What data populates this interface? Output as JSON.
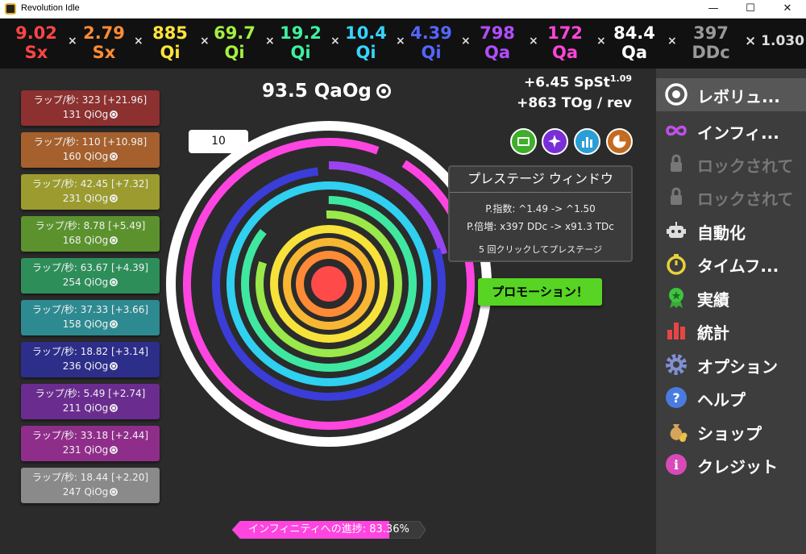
{
  "window": {
    "title": "Revolution Idle",
    "minimize": "—",
    "maximize": "☐",
    "close": "✕"
  },
  "multipliers": [
    {
      "value": "9.02",
      "suffix": "Sx",
      "color": "#ff4545"
    },
    {
      "value": "2.79",
      "suffix": "Sx",
      "color": "#ff8c35"
    },
    {
      "value": "885",
      "suffix": "Qi",
      "color": "#ffe43a"
    },
    {
      "value": "69.7",
      "suffix": "Qi",
      "color": "#a4f040"
    },
    {
      "value": "19.2",
      "suffix": "Qi",
      "color": "#3ff0a0"
    },
    {
      "value": "10.4",
      "suffix": "Qi",
      "color": "#35d5ff"
    },
    {
      "value": "4.39",
      "suffix": "Qi",
      "color": "#5566ff"
    },
    {
      "value": "798",
      "suffix": "Qa",
      "color": "#b24dff"
    },
    {
      "value": "172",
      "suffix": "Qa",
      "color": "#ff45d8"
    },
    {
      "value": "84.4",
      "suffix": "Qa",
      "color": "#ffffff"
    },
    {
      "value": "397",
      "suffix": "DDc",
      "color": "#999999"
    }
  ],
  "multiplier_sep": "×",
  "final_multiplier": "× 1.030",
  "rings": [
    {
      "rate": "ラップ/秒: 323 [+21.96]",
      "cost": "131 QiOg",
      "color": "#8c3030"
    },
    {
      "rate": "ラップ/秒: 110 [+10.98]",
      "cost": "160 QiOg",
      "color": "#a5602d"
    },
    {
      "rate": "ラップ/秒: 42.45 [+7.32]",
      "cost": "231 QiOg",
      "color": "#9b9b2f"
    },
    {
      "rate": "ラップ/秒: 8.78 [+5.49]",
      "cost": "168 QiOg",
      "color": "#5b922e"
    },
    {
      "rate": "ラップ/秒: 63.67 [+4.39]",
      "cost": "254 QiOg",
      "color": "#2e8e5a"
    },
    {
      "rate": "ラップ/秒: 37.33 [+3.66]",
      "cost": "158 QiOg",
      "color": "#2e8a91"
    },
    {
      "rate": "ラップ/秒: 18.82 [+3.14]",
      "cost": "236 QiOg",
      "color": "#2d2d8a"
    },
    {
      "rate": "ラップ/秒: 5.49 [+2.74]",
      "cost": "211 QiOg",
      "color": "#6a2d8f"
    },
    {
      "rate": "ラップ/秒: 33.18 [+2.44]",
      "cost": "231 QiOg",
      "color": "#8f2d8a"
    },
    {
      "rate": "ラップ/秒: 18.44 [+2.20]",
      "cost": "247 QiOg",
      "color": "#8a8a8a"
    }
  ],
  "currency": {
    "amount": "93.5 QaOg"
  },
  "rates": {
    "spst": "+6.45 SpSt",
    "spst_exp": "1.09",
    "per_rev": "+863 TOg / rev"
  },
  "count_box": "10",
  "buttons": [
    {
      "name": "cash-icon",
      "color": "#3fae2a"
    },
    {
      "name": "sparkle-icon",
      "color": "#7a2fd6"
    },
    {
      "name": "bar-chart-icon",
      "color": "#2a9ed6"
    },
    {
      "name": "pie-chart-icon",
      "color": "#c46a1f"
    }
  ],
  "prestige": {
    "title": "プレステージ ウィンドウ",
    "exponent": "P.指数: ^1.49 -> ^1.50",
    "multiplier": "P.倍増: x397 DDc -> x91.3 TDc",
    "hint": "5 回クリックしてプレステージ"
  },
  "promotion": "プロモーション！",
  "progress": {
    "label": "インフィニティへの進捗: 83.36%",
    "fraction": 0.8336,
    "fill": "#ff45e0"
  },
  "sidebar": [
    {
      "label": "レボリュ...",
      "icon": "target-icon",
      "active": true,
      "locked": false
    },
    {
      "label": "インフィ...",
      "icon": "infinity-icon",
      "active": false,
      "locked": false
    },
    {
      "label": "ロックされて",
      "icon": "lock-icon",
      "active": false,
      "locked": true
    },
    {
      "label": "ロックされて",
      "icon": "lock-icon",
      "active": false,
      "locked": true
    },
    {
      "label": "自動化",
      "icon": "robot-icon",
      "active": false,
      "locked": false
    },
    {
      "label": "タイムフ...",
      "icon": "stopwatch-icon",
      "active": false,
      "locked": false
    },
    {
      "label": "実績",
      "icon": "medal-icon",
      "active": false,
      "locked": false
    },
    {
      "label": "統計",
      "icon": "bar-chart-icon",
      "active": false,
      "locked": false
    },
    {
      "label": "オプション",
      "icon": "gear-icon",
      "active": false,
      "locked": false
    },
    {
      "label": "ヘルプ",
      "icon": "help-icon",
      "active": false,
      "locked": false
    },
    {
      "label": "ショップ",
      "icon": "money-bag-icon",
      "active": false,
      "locked": false
    },
    {
      "label": "クレジット",
      "icon": "info-icon",
      "active": false,
      "locked": false
    }
  ]
}
